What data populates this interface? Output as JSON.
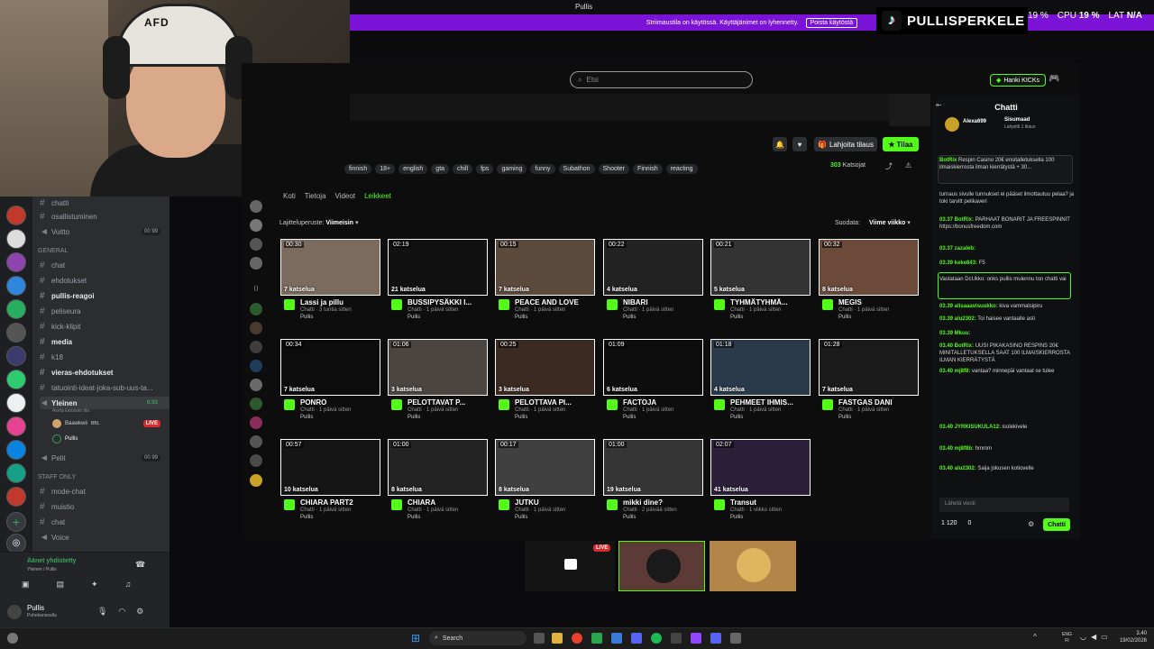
{
  "window": {
    "title": "Pullis",
    "controls": "— ▢ ✕"
  },
  "banner": {
    "text": "Striimaustila on käytössä. Käyttäjänimet on lyhennetty.",
    "button": "Poista käytöstä"
  },
  "overlay": {
    "name": "PULLISPERKELE",
    "gpu": "19 %",
    "cpu_label": "CPU",
    "cpu": "19 %",
    "lat_label": "LAT",
    "lat": "N/A"
  },
  "cam": {
    "cap_text": "AFD"
  },
  "discord": {
    "channels_top": [
      "chatti",
      "osallistuminen",
      "Voitto"
    ],
    "voitto_count": "00 99",
    "category_general": "GENERAL",
    "channels_general": [
      "chat",
      "ehdotukset",
      "pullis-reagoi",
      "peliseura",
      "kick-klipit",
      "media",
      "k18",
      "vieras-ehdotukset",
      "tatuointi-ideat-joka-sub-uus-ta..."
    ],
    "voice_channel": "Yleinen",
    "voice_count": "0:53",
    "voice_status": "Aseta kanavan tila",
    "voice_user1": "Baawkwii",
    "voice_user1_tag": "BBL",
    "voice_live": "LIVE",
    "voice_user2": "Pullis",
    "channel_pelit": "Pelit",
    "pelit_count": "00 99",
    "category_staff": "STAFF ONLY",
    "channels_staff": [
      "mode-chat",
      "muistio",
      "chat",
      "Voice"
    ],
    "voice_connected": "Äänet yhdistetty",
    "voice_connected_sub": "Yleinen / Pullis",
    "user_name": "Pullis",
    "user_status": "Puhekanavalla"
  },
  "kick": {
    "search_placeholder": "Etsi",
    "hanki": "Hanki KICKs",
    "donate": "Lahjoita tilaus",
    "subscribe": "Tilaa",
    "viewers": "303",
    "viewers_label": "Katsojat",
    "tags": [
      "finnish",
      "18+",
      "english",
      "gta",
      "chill",
      "fps",
      "gaming",
      "funny",
      "Subathon",
      "Shooter",
      "Finnish",
      "reacting"
    ],
    "tabs": [
      "Koti",
      "Tietoja",
      "Videot",
      "Leikkeet"
    ],
    "sort_label": "Lajitteluperuste:",
    "sort_value": "Viimeisin",
    "filter_label": "Suodata:",
    "filter_value": "Viime viikko",
    "clips": [
      {
        "duration": "00:30",
        "views": "7 katselua",
        "title": "Lassi ja pillu",
        "sub": "Chatti · 3 tuntia sitten",
        "user": "Pullis"
      },
      {
        "duration": "02:19",
        "views": "21 katselua",
        "title": "BUSSIPYSÄKKI I...",
        "sub": "Chatti · 1 päivä sitten",
        "user": "Pullis"
      },
      {
        "duration": "00:15",
        "views": "7 katselua",
        "title": "PEACE AND LOVE",
        "sub": "Chatti · 1 päivä sitten",
        "user": "Pullis"
      },
      {
        "duration": "00:22",
        "views": "4 katselua",
        "title": "NIBARI",
        "sub": "Chatti · 1 päivä sitten",
        "user": "Pullis"
      },
      {
        "duration": "00:21",
        "views": "5 katselua",
        "title": "TYHMÄTYHMÄ...",
        "sub": "Chatti · 1 päivä sitten",
        "user": "Pullis"
      },
      {
        "duration": "00:32",
        "views": "8 katselua",
        "title": "MEGIS",
        "sub": "Chatti · 1 päivä sitten",
        "user": "Pullis"
      },
      {
        "duration": "00:34",
        "views": "7 katselua",
        "title": "PONRO",
        "sub": "Chatti · 1 päivä sitten",
        "user": "Pullis"
      },
      {
        "duration": "01:06",
        "views": "3 katselua",
        "title": "PELOTTAVAT P...",
        "sub": "Chatti · 1 päivä sitten",
        "user": "Pullis"
      },
      {
        "duration": "00:25",
        "views": "3 katselua",
        "title": "PELOTTAVA PI...",
        "sub": "Chatti · 1 päivä sitten",
        "user": "Pullis"
      },
      {
        "duration": "01:09",
        "views": "6 katselua",
        "title": "FACTOJA",
        "sub": "Chatti · 1 päivä sitten",
        "user": "Pullis"
      },
      {
        "duration": "01:18",
        "views": "4 katselua",
        "title": "PEHMEET IHMIS...",
        "sub": "Chatti · 1 päivä sitten",
        "user": "Pullis"
      },
      {
        "duration": "01:28",
        "views": "7 katselua",
        "title": "FASTGAS DANI",
        "sub": "Chatti · 1 päivä sitten",
        "user": "Pullis"
      },
      {
        "duration": "00:57",
        "views": "10 katselua",
        "title": "CHIARA PART2",
        "sub": "Chatti · 1 päivä sitten",
        "user": "Pullis"
      },
      {
        "duration": "01:00",
        "views": "8 katselua",
        "title": "CHIARA",
        "sub": "Chatti · 1 päivä sitten",
        "user": "Pullis"
      },
      {
        "duration": "00:17",
        "views": "8 katselua",
        "title": "JUTKU",
        "sub": "Chatti · 1 päivä sitten",
        "user": "Pullis"
      },
      {
        "duration": "01:00",
        "views": "19 katselua",
        "title": "mikki dine?",
        "sub": "Chatti · 2 päivää sitten",
        "user": "Pullis"
      },
      {
        "duration": "02:07",
        "views": "41 katselua",
        "title": "Transut",
        "sub": "Chatti · 1 viikko sitten",
        "user": "Pullis"
      }
    ]
  },
  "chat": {
    "title": "Chatti",
    "top_user": "Alexa699",
    "top_user2": "Sisumaad",
    "top_note": "Lahjoitti 1 tilaus",
    "lines": [
      {
        "user": "BotRix",
        "text": "Respin Casino 20€ ensitalletuksella 100 ilmaiskierrosta ilman kierrätystä + 30..."
      },
      {
        "user": "",
        "text": "turnaus sivulle tunnukset ei pääset ilmottautuu pelaa? ja toki tarvitt pelikaveri"
      },
      {
        "user": "03.37 BotRix:",
        "text": "PARHAAT BONARIT JA FREESPINNIT https://bonusfreedom.com"
      },
      {
        "user": "03.37 zazaleb:",
        "text": ""
      },
      {
        "user": "03.39 keke843:",
        "text": "F5"
      },
      {
        "user": "",
        "text": "Vastataan DcUkko: onks pullis mulennu ton chatti vai"
      },
      {
        "user": "03.39 alisaaavisuukko:",
        "text": "kiva vammalsipiru"
      },
      {
        "user": "03.39 alu2302:",
        "text": "Toi haisee vantaalle asti"
      },
      {
        "user": "03.39 Mkuu:",
        "text": ""
      },
      {
        "user": "03.40 BotRix:",
        "text": "UUSI PIKAKASINO RESPINS 20€ MINITALLETUKSELLA SAAT 100 ILMAISKIERROSTA ILMAN KIERRÄTYSTÄ"
      },
      {
        "user": "03.40 mj8f8:",
        "text": "vantaa? minnepäi vantaat se tulee"
      },
      {
        "user": "03.40 JYRKISUKULA12:",
        "text": "isolekivele"
      },
      {
        "user": "03.40 mj8f8b:",
        "text": "hmmm"
      },
      {
        "user": "03.40 alu2302:",
        "text": "Saija jokusen kotiovelle"
      }
    ],
    "input_placeholder": "Lähetä viesti",
    "points": "1 120",
    "points2": "0",
    "send": "Chatti"
  },
  "taskbar": {
    "search": "Search",
    "lang": "ENG",
    "lang2": "FI",
    "time": "3.40",
    "date": "19/02/2026"
  }
}
